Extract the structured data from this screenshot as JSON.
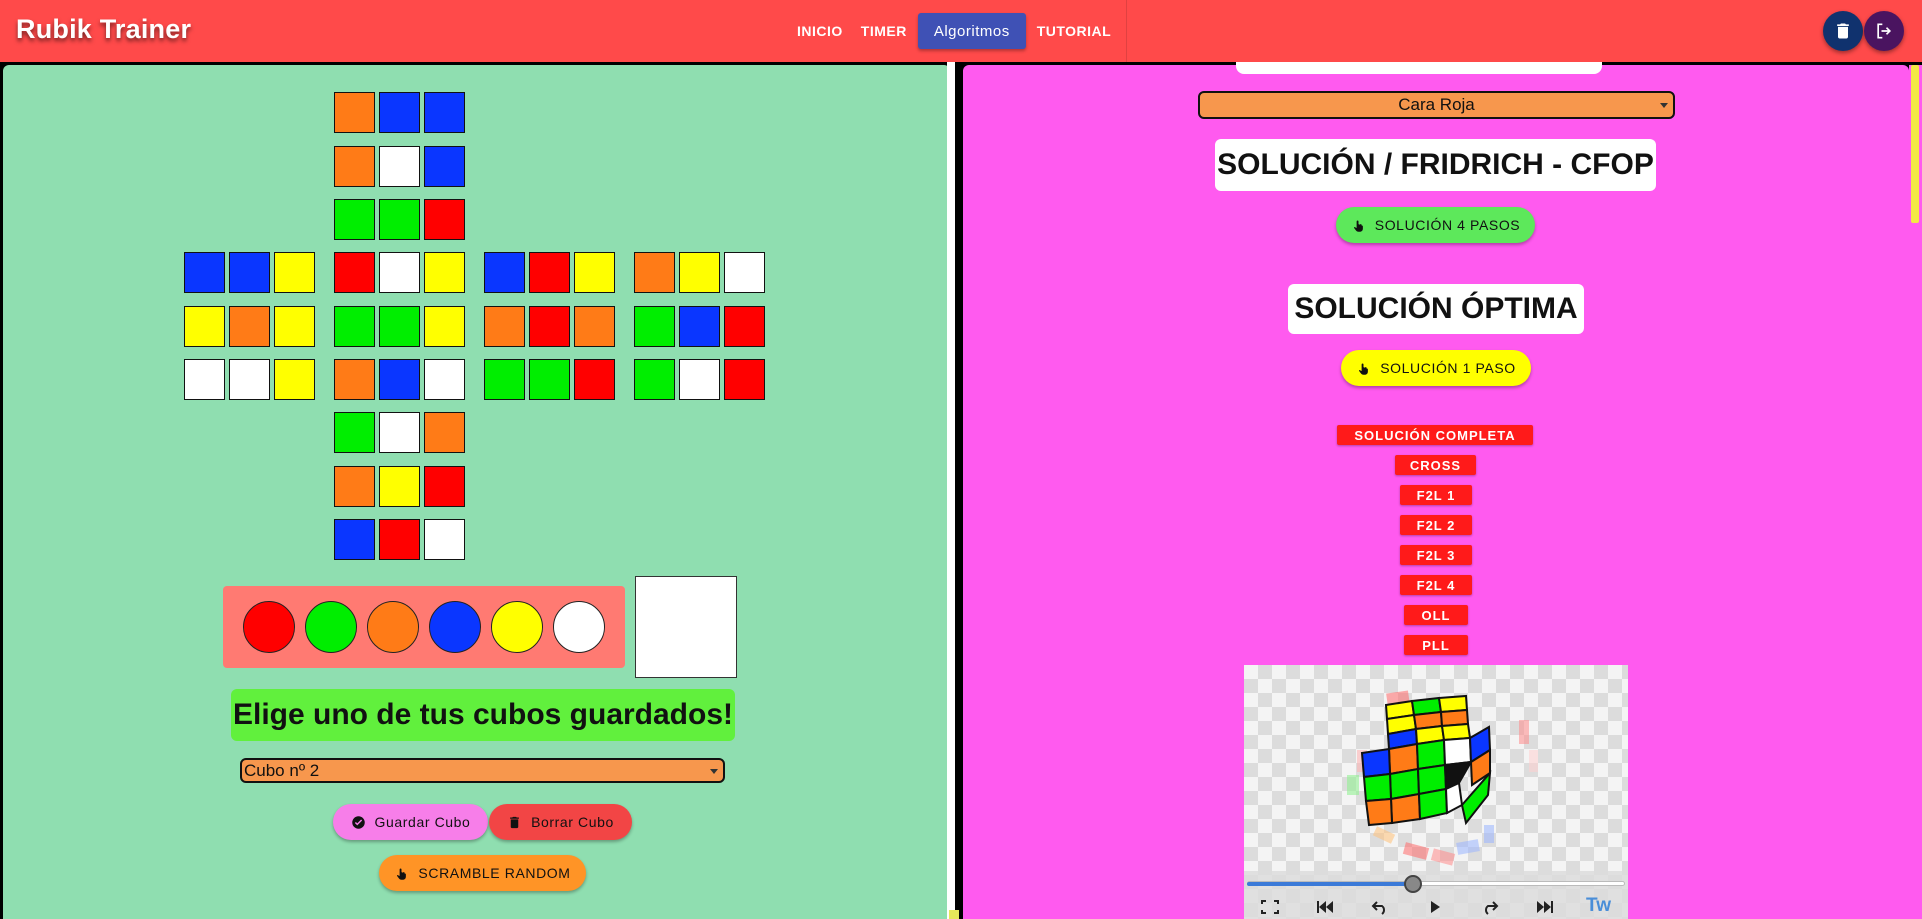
{
  "app": {
    "title": "Rubik Trainer",
    "nav": [
      {
        "label": "INICIO",
        "active": false
      },
      {
        "label": "TIMER",
        "active": false
      },
      {
        "label": "Algoritmos",
        "active": true
      },
      {
        "label": "TUTORIAL",
        "active": false
      }
    ],
    "colors": {
      "topbar": "#ff4a4a",
      "active_nav": "#3f51b5",
      "left_panel": "#8fdeb0",
      "right_panel": "#ff5aef"
    },
    "actions": [
      {
        "icon": "trash-icon",
        "color": "#10326e"
      },
      {
        "icon": "logout-icon",
        "color": "#4a1460"
      }
    ]
  },
  "cube": {
    "up": [
      "orange",
      "blue",
      "blue",
      "orange",
      "white",
      "blue",
      "green",
      "green",
      "red"
    ],
    "left": [
      "blue",
      "blue",
      "yellow",
      "yellow",
      "orange",
      "yellow",
      "white",
      "white",
      "yellow"
    ],
    "front": [
      "red",
      "white",
      "yellow",
      "green",
      "green",
      "yellow",
      "orange",
      "blue",
      "white"
    ],
    "right": [
      "blue",
      "red",
      "yellow",
      "orange",
      "red",
      "orange",
      "green",
      "green",
      "red"
    ],
    "back": [
      "orange",
      "yellow",
      "white",
      "green",
      "blue",
      "red",
      "green",
      "white",
      "red"
    ],
    "down": [
      "green",
      "white",
      "orange",
      "orange",
      "yellow",
      "red",
      "blue",
      "red",
      "white"
    ],
    "palette": [
      "red",
      "green",
      "orange",
      "blue",
      "yellow",
      "white"
    ],
    "selected_color": "white",
    "color_hex": {
      "red": "#ff0000",
      "green": "#00ee00",
      "orange": "#ff7b17",
      "blue": "#0a36ff",
      "yellow": "#ffff00",
      "white": "#ffffff"
    }
  },
  "saved": {
    "title": "Elige uno de tus cubos guardados!",
    "selected": "Cubo nº 2",
    "save_label": "Guardar Cubo",
    "delete_label": "Borrar Cubo",
    "scramble_label": "SCRAMBLE RANDOM"
  },
  "solution": {
    "face_selected": "Cara Roja",
    "fridrich_title": "SOLUCIÓN / FRIDRICH - CFOP",
    "four_steps_label": "SOLUCIÓN 4 PASOS",
    "optimal_title": "SOLUCIÓN ÓPTIMA",
    "one_step_label": "SOLUCIÓN 1 PASO",
    "steps": [
      "SOLUCIÓN COMPLETA",
      "CROSS",
      "F2L 1",
      "F2L 2",
      "F2L 3",
      "F2L 4",
      "OLL",
      "PLL"
    ]
  },
  "player": {
    "progress": 0.44,
    "twisty_label": "Tw",
    "controls": [
      "fullscreen-icon",
      "skip-start-icon",
      "step-back-icon",
      "play-icon",
      "step-forward-icon",
      "skip-end-icon"
    ]
  }
}
